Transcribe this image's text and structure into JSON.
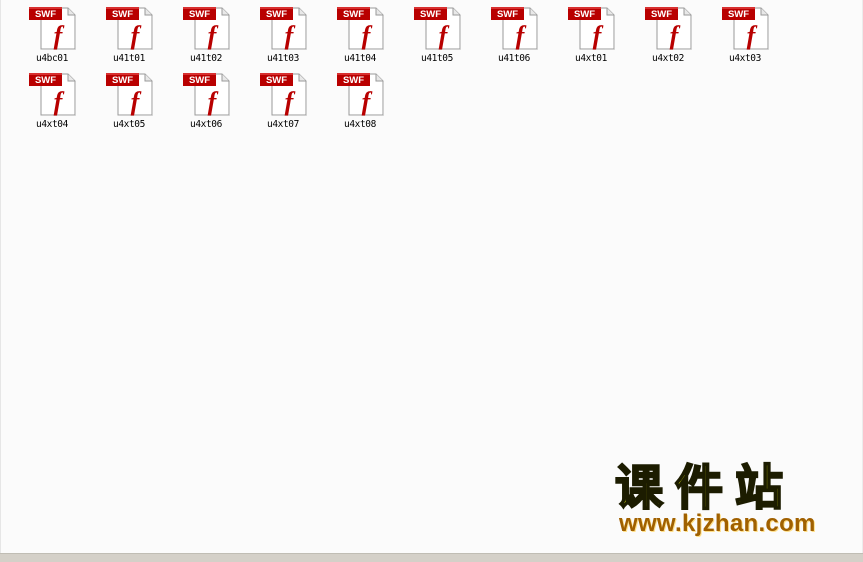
{
  "explorer": {
    "badge_text": "SWF",
    "files": [
      {
        "name": "u4bc01"
      },
      {
        "name": "u41t01"
      },
      {
        "name": "u41t02"
      },
      {
        "name": "u41t03"
      },
      {
        "name": "u41t04"
      },
      {
        "name": "u41t05"
      },
      {
        "name": "u41t06"
      },
      {
        "name": "u4xt01"
      },
      {
        "name": "u4xt02"
      },
      {
        "name": "u4xt03"
      },
      {
        "name": "u4xt04"
      },
      {
        "name": "u4xt05"
      },
      {
        "name": "u4xt06"
      },
      {
        "name": "u4xt07"
      },
      {
        "name": "u4xt08"
      }
    ],
    "icon_name": "swf-file-icon",
    "colors": {
      "badge": "#b90000",
      "flash_f": "#b80000",
      "page": "#ffffff",
      "background": "#fbfbfb"
    }
  },
  "watermark": {
    "title": "课件站",
    "url": "www.kjzhan.com",
    "colors": {
      "title": "#e8ef10",
      "url": "#a06000"
    }
  }
}
